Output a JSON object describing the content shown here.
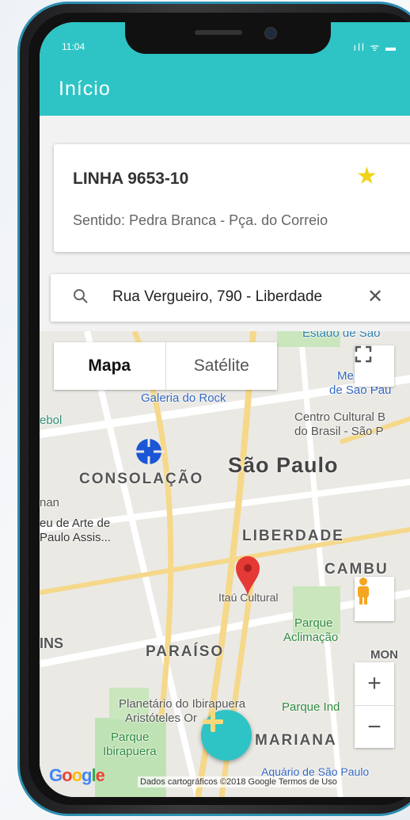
{
  "status": {
    "time": "11:04",
    "icons": "ıll ᯤ ▬"
  },
  "header": {
    "title": "Início"
  },
  "line_card": {
    "title": "LINHA 9653-10",
    "direction": "Sentido: Pedra Branca - Pça. do Correio",
    "favorite_icon": "star-icon",
    "star_color": "#f2d31b"
  },
  "search": {
    "value": "Rua Vergueiro, 790 - Liberdade",
    "clear_icon": "close-icon"
  },
  "map": {
    "map_type_options": [
      "Mapa",
      "Satélite"
    ],
    "selected_map_type": "Mapa",
    "zoom_in": "+",
    "zoom_out": "−",
    "google": "Google",
    "credit": "Dados cartográficos ©2018 Google   Termos de Uso",
    "labels": {
      "estado": "Estado de São",
      "galeria": "Galeria do Rock",
      "mer": "Mer",
      "desao": "de São Pau",
      "ccb1": "Centro Cultural B",
      "ccb2": "do Brasil - São P",
      "ebol": "ebol",
      "saopaulo": "São Paulo",
      "consolacao": "CONSOLAÇÃO",
      "nan": "nan",
      "museu1": "eu de Arte de",
      "museu2": "Paulo Assis...",
      "liberdade": "LIBERDADE",
      "cambu": "CAMBU",
      "itau": "Itaú Cultural",
      "parque1": "Parque",
      "parque2": "Aclimação",
      "ins": "INS",
      "paraiso": "PARAÍSO",
      "mon": "MON",
      "planetario1": "Planetário do Ibirapuera",
      "planetario2": "Aristóteles Or",
      "parqueind": "Parque Ind",
      "ibira1": "Parque",
      "ibira2": "Ibirapuera",
      "mariana": "MARIANA",
      "aquario": "Aquário de São Paulo"
    }
  },
  "colors": {
    "accent": "#2ec4c6",
    "pin": "#e53935",
    "location": "#1a56d6"
  }
}
